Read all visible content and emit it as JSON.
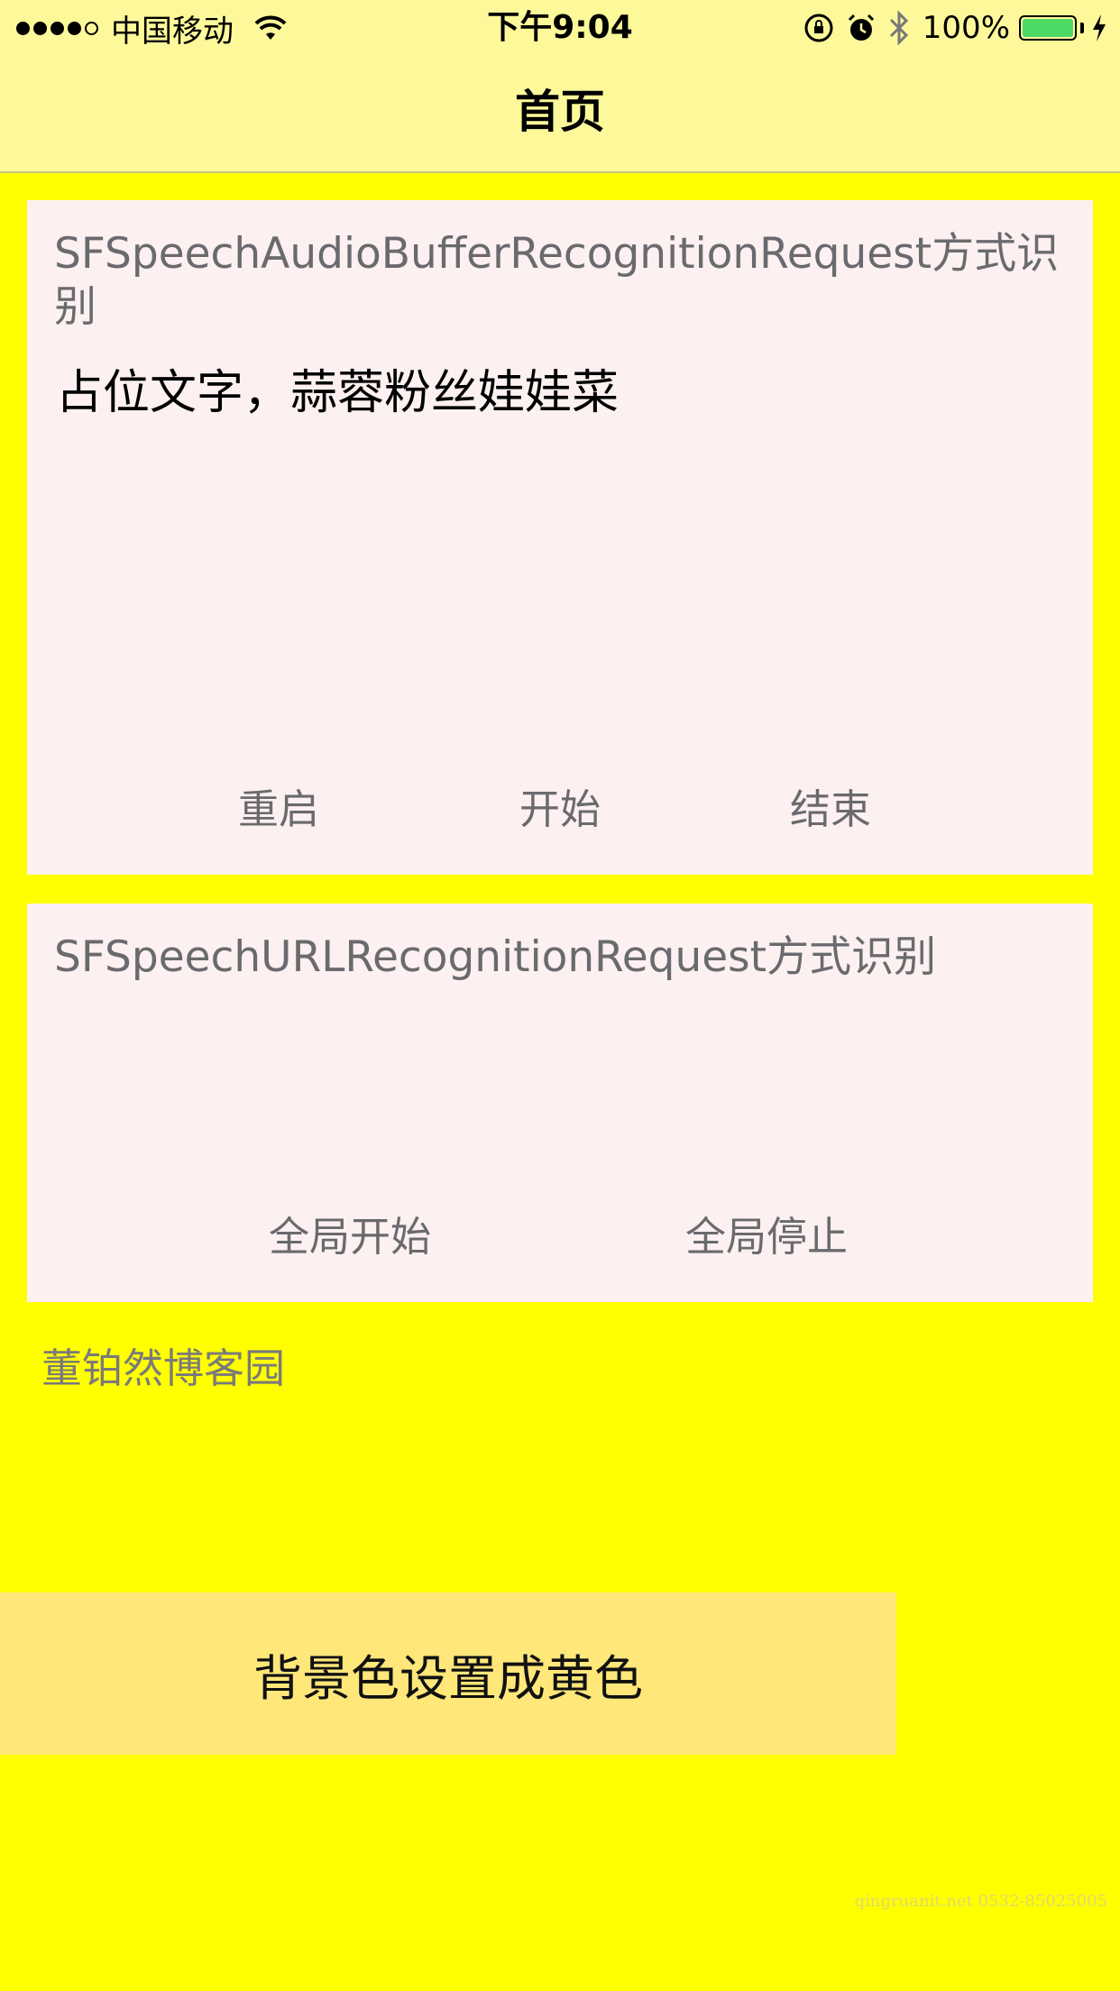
{
  "status_bar": {
    "carrier": "中国移动",
    "time": "下午9:04",
    "battery_percent": "100%",
    "battery_level": 1.0,
    "signal_bars": 4,
    "signal_total": 5
  },
  "nav": {
    "title": "首页"
  },
  "buffer_section": {
    "title": "SFSpeechAudioBufferRecognitionRequest方式识别",
    "text": "占位文字，蒜蓉粉丝娃娃菜",
    "restart_label": "重启",
    "start_label": "开始",
    "end_label": "结束"
  },
  "url_section": {
    "title": "SFSpeechURLRecognitionRequest方式识别",
    "global_start_label": "全局开始",
    "global_stop_label": "全局停止"
  },
  "footer": {
    "blog_text": "董铂然博客园",
    "bg_button_label": "背景色设置成黄色",
    "watermark": "qingruanit.net 0532-85025005"
  },
  "colors": {
    "background": "#FFFF00",
    "nav_bar": "#FDF99A",
    "card": "#FCF0F0",
    "button_bg": "#FFE77A",
    "battery": "#4CD964"
  }
}
